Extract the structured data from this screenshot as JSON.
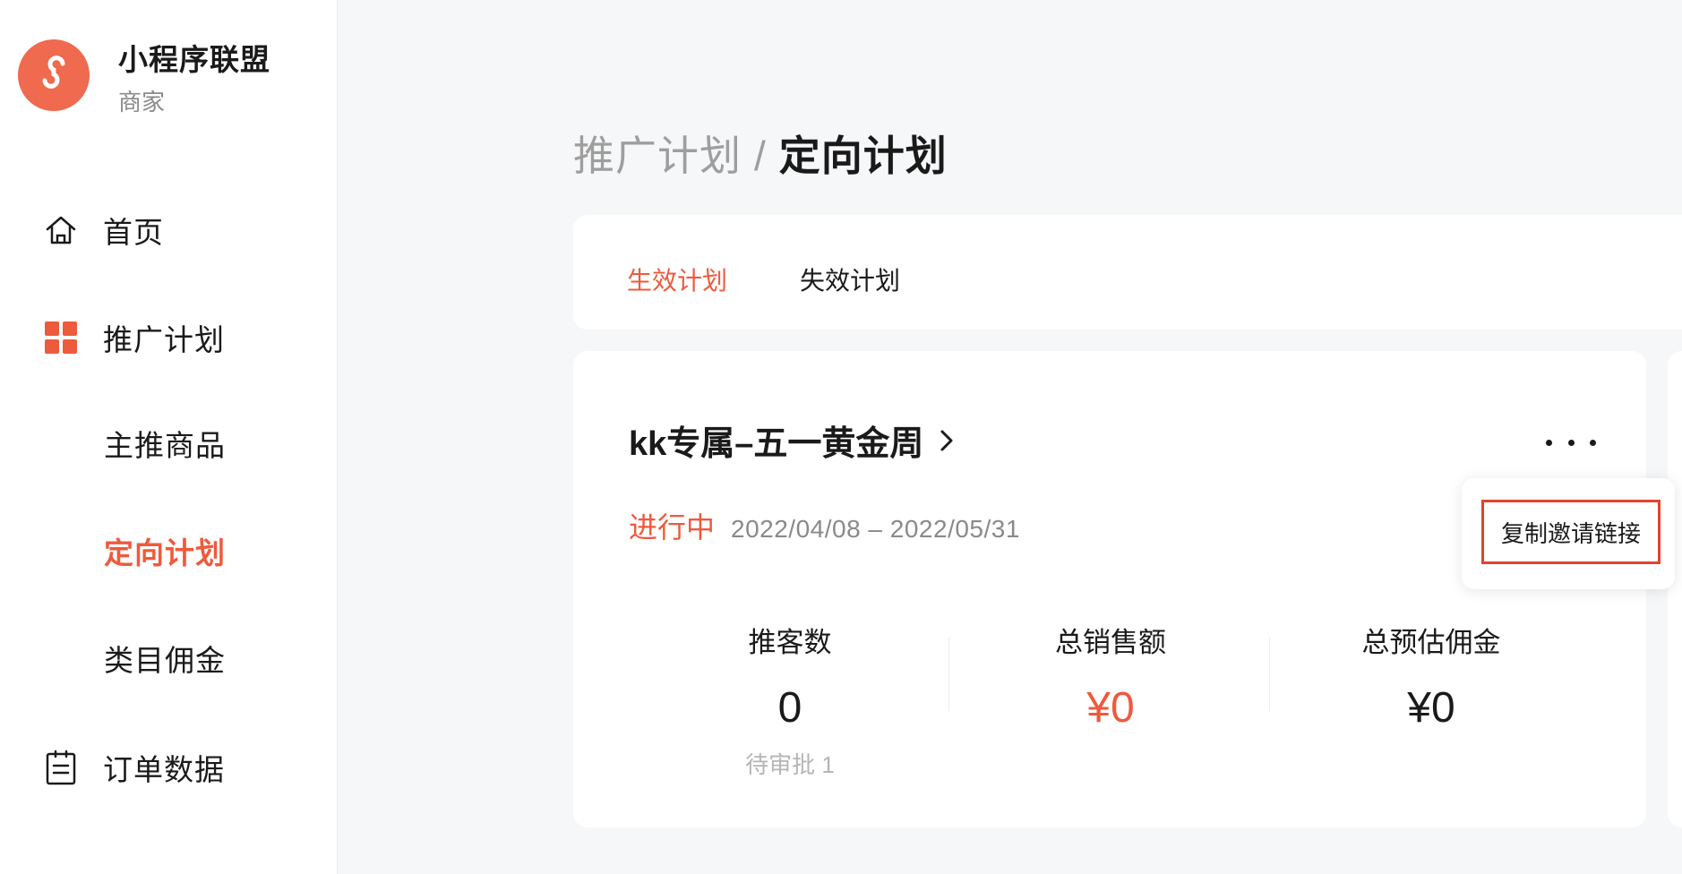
{
  "app": {
    "title": "小程序联盟",
    "subtitle": "商家",
    "brand_color": "#ee5a3c"
  },
  "sidebar": {
    "items": [
      {
        "label": "首页",
        "icon": "home-icon"
      },
      {
        "label": "推广计划",
        "icon": "grid-icon"
      },
      {
        "label": "主推商品"
      },
      {
        "label": "定向计划",
        "active": true
      },
      {
        "label": "类目佣金"
      },
      {
        "label": "订单数据",
        "icon": "clipboard-icon"
      }
    ]
  },
  "breadcrumb": {
    "parent": "推广计划",
    "separator": "/",
    "current": "定向计划"
  },
  "tabs": [
    {
      "label": "生效计划",
      "active": true
    },
    {
      "label": "失效计划"
    }
  ],
  "plan": {
    "title": "kk专属–五一黄金周",
    "status": "进行中",
    "date_range": "2022/04/08 – 2022/05/31",
    "stats": [
      {
        "label": "推客数",
        "value": "0",
        "sub": "待审批 1"
      },
      {
        "label": "总销售额",
        "value": "¥0"
      },
      {
        "label": "总预估佣金",
        "value": "¥0"
      }
    ]
  },
  "popover": {
    "item": "复制邀请链接"
  }
}
